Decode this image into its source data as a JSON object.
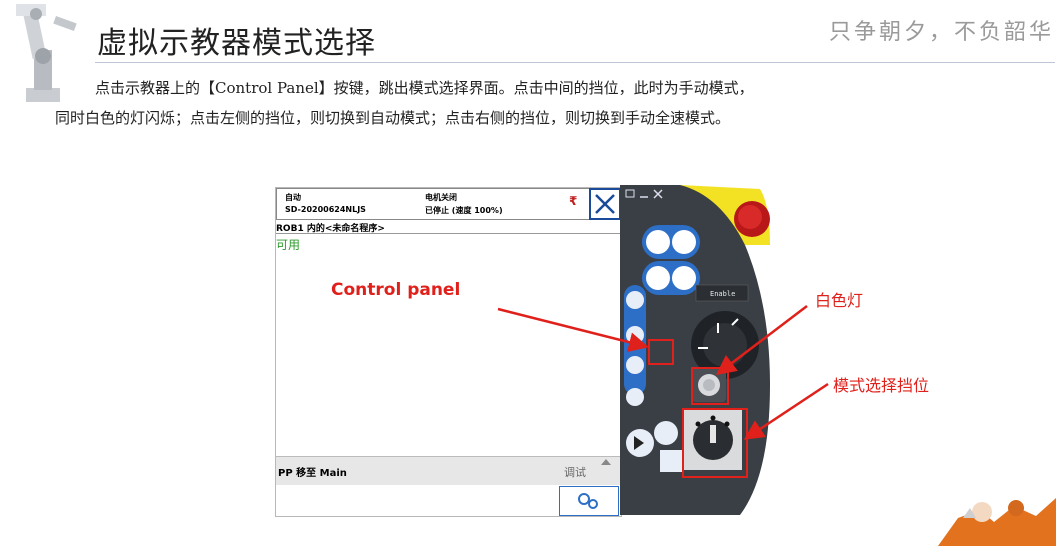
{
  "title": "虚拟示教器模式选择",
  "slogan": "只争朝夕，不负韶华",
  "paragraph": {
    "line1": "点击示教器上的【Control Panel】按键，跳出模式选择界面。点击中间的挡位，此时为手动模式，",
    "line2": "同时白色的灯闪烁；点击左侧的挡位，则切换到自动模式；点击右侧的挡位，则切换到手动全速模式。"
  },
  "screen": {
    "mode": "自动",
    "system": "SD-20200624NLJS",
    "motor": "电机关闭",
    "speed": "已停止 (速度 100%)",
    "program": "ROB1 内的<未命名程序>",
    "available": "可用",
    "pp_button": "PP 移至 Main",
    "debug_button": "调试"
  },
  "pendant": {
    "enable_label": "Enable"
  },
  "annotations": {
    "control_panel": "Control panel",
    "white_light": "白色灯",
    "mode_switch": "模式选择挡位"
  },
  "colors": {
    "accent_red": "#e0201b",
    "available_green": "#2e9a2e",
    "pendant_blue": "#2d6fc6",
    "pendant_dark": "#3a3f45",
    "pendant_yellow": "#f3e223"
  }
}
